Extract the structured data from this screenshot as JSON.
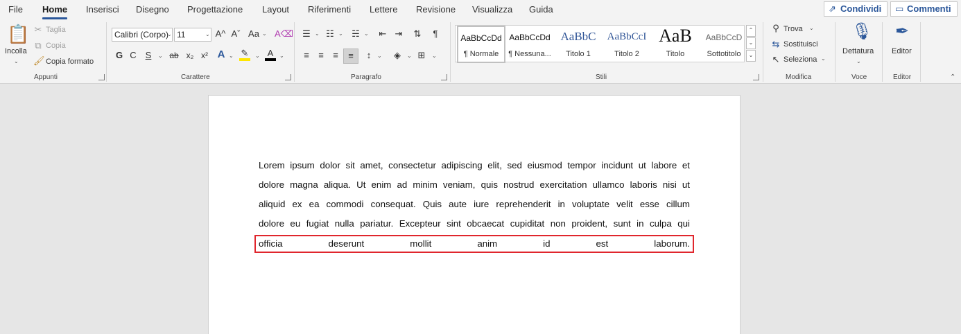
{
  "menu": {
    "tabs": [
      "File",
      "Home",
      "Inserisci",
      "Disegno",
      "Progettazione",
      "Layout",
      "Riferimenti",
      "Lettere",
      "Revisione",
      "Visualizza",
      "Guida"
    ],
    "share_label": "Condividi",
    "comments_label": "Commenti"
  },
  "ribbon": {
    "clipboard": {
      "paste_label": "Incolla",
      "cut_label": "Taglia",
      "copy_label": "Copia",
      "format_painter_label": "Copia formato",
      "group_label": "Appunti"
    },
    "font": {
      "font_name": "Calibri (Corpo)",
      "font_size": "11",
      "group_label": "Carattere",
      "bold": "G",
      "italic": "C",
      "underline": "S",
      "strike": "ab"
    },
    "paragraph": {
      "group_label": "Paragrafo"
    },
    "styles": {
      "group_label": "Stili",
      "items": [
        {
          "preview": "AaBbCcDd",
          "name": "¶ Normale"
        },
        {
          "preview": "AaBbCcDd",
          "name": "¶ Nessuna..."
        },
        {
          "preview": "AaBbC",
          "name": "Titolo 1"
        },
        {
          "preview": "AaBbCcI",
          "name": "Titolo 2"
        },
        {
          "preview": "AaB",
          "name": "Titolo"
        },
        {
          "preview": "AaBbCcD",
          "name": "Sottotitolo"
        }
      ]
    },
    "editing": {
      "find_label": "Trova",
      "replace_label": "Sostituisci",
      "select_label": "Seleziona",
      "group_label": "Modifica"
    },
    "voice": {
      "dictate_label": "Dettatura",
      "group_label": "Voce"
    },
    "editor": {
      "editor_label": "Editor",
      "group_label": "Editor"
    }
  },
  "document": {
    "lines": [
      "Lorem ipsum dolor sit amet, consectetur adipiscing elit, sed eiusmod tempor incidunt ut labore et",
      "dolore magna aliqua. Ut enim ad minim veniam, quis nostrud exercitation ullamco laboris nisi ut",
      "aliquid ex ea commodi consequat. Quis aute iure reprehenderit in voluptate velit esse cillum",
      "dolore eu fugiat nulla pariatur. Excepteur sint obcaecat cupiditat non proident, sunt in culpa qui",
      "officia deserunt mollit anim id est laborum."
    ]
  },
  "colors": {
    "accent": "#2b579a",
    "highlight_box": "#e0262d"
  }
}
